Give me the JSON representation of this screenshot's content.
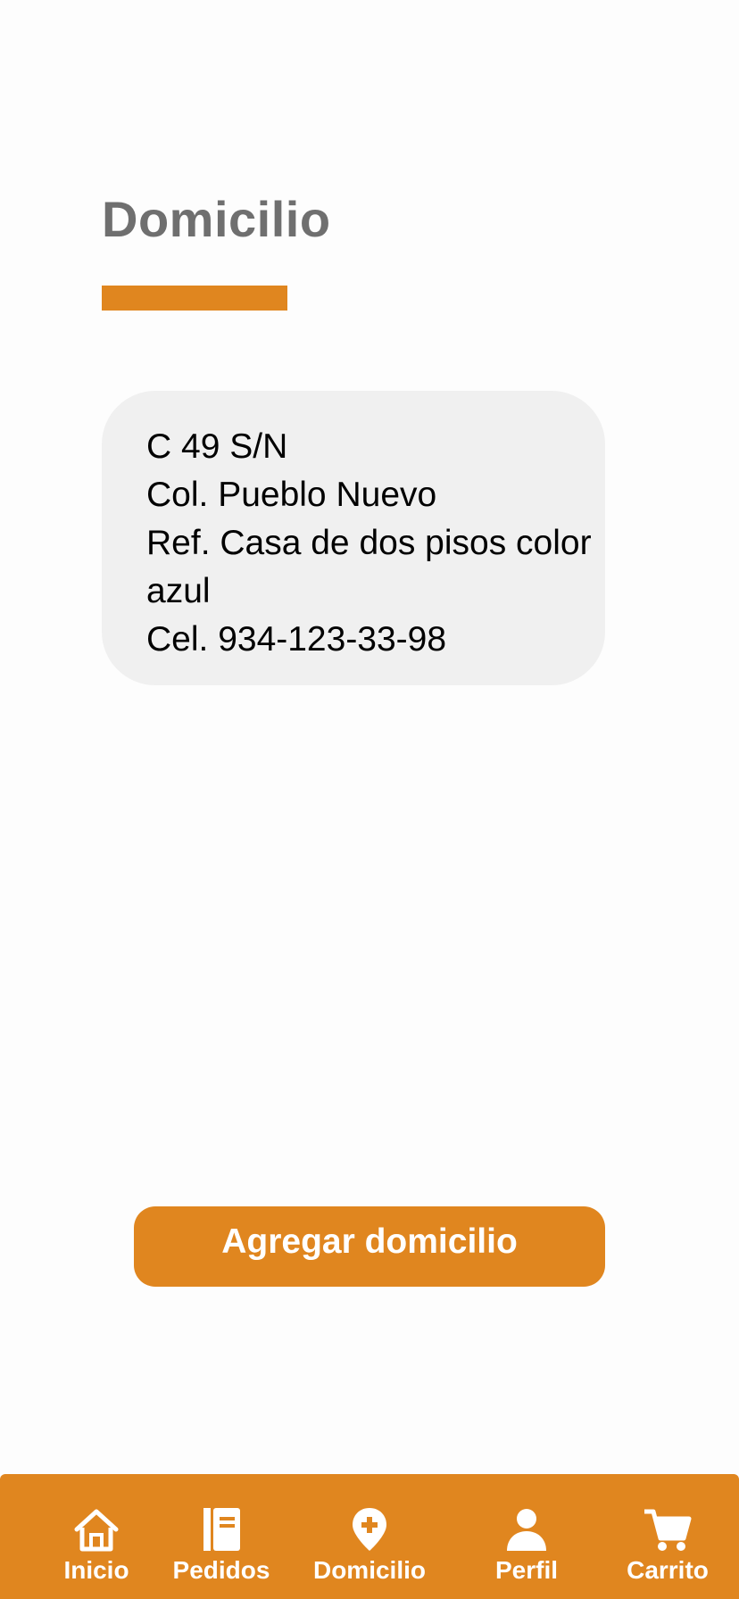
{
  "header": {
    "title": "Domicilio"
  },
  "address": {
    "lines": [
      "C 49 S/N",
      "Col. Pueblo Nuevo",
      "Ref. Casa de dos pisos color azul",
      "Cel. 934-123-33-98"
    ]
  },
  "actions": {
    "add_address_label": "Agregar domicilio"
  },
  "nav": {
    "items": [
      {
        "label": "Inicio",
        "icon": "home-icon"
      },
      {
        "label": "Pedidos",
        "icon": "notebook-icon"
      },
      {
        "label": "Domicilio",
        "icon": "location-plus-icon"
      },
      {
        "label": "Perfil",
        "icon": "user-icon"
      },
      {
        "label": "Carrito",
        "icon": "cart-icon"
      }
    ]
  },
  "colors": {
    "accent": "#e0861f",
    "title": "#6f6f6f",
    "card_background": "#f0f0f0",
    "page_background": "#fdfdfd"
  }
}
